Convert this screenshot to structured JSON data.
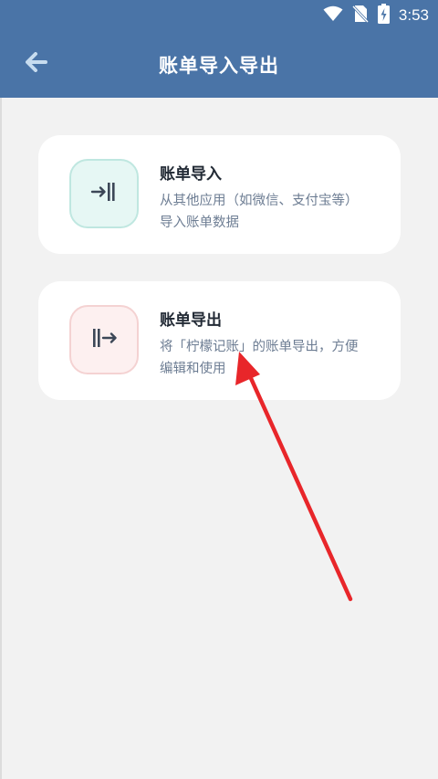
{
  "status_bar": {
    "time": "3:53",
    "icons": [
      "wifi-icon",
      "no-sim-icon",
      "battery-charging-icon"
    ]
  },
  "header": {
    "title": "账单导入导出",
    "back_icon": "arrow-left-icon"
  },
  "options": [
    {
      "title": "账单导入",
      "description": "从其他应用（如微信、支付宝等）导入账单数据",
      "icon": "import-icon",
      "icon_color": "#3c4757",
      "icon_bg": "#e6f7f4",
      "icon_border": "#bfe7e0"
    },
    {
      "title": "账单导出",
      "description": "将「柠檬记账」的账单导出，方便编辑和使用",
      "icon": "export-icon",
      "icon_color": "#3c4757",
      "icon_bg": "#fdf0f0",
      "icon_border": "#f4d2d2"
    }
  ],
  "colors": {
    "header_bg": "#4a74a7",
    "page_bg": "#f2f2f2",
    "annotation_arrow": "#e8262a"
  }
}
